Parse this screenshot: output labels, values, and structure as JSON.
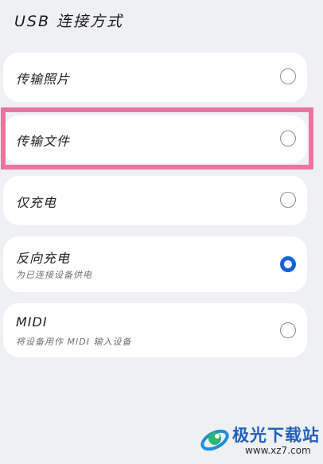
{
  "screen": {
    "title": "USB 连接方式"
  },
  "options": [
    {
      "label": "传输照片",
      "selected": false
    },
    {
      "label": "传输文件",
      "selected": false,
      "highlighted": true
    },
    {
      "label": "仅充电",
      "selected": false
    },
    {
      "label": "反向充电",
      "sublabel": "为已连接设备供电",
      "selected": true
    },
    {
      "label": "MIDI",
      "sublabel": "将设备用作 MIDI 输入设备",
      "selected": false
    }
  ],
  "watermark": {
    "name": "极光下载站",
    "url": "www.xz7.com"
  },
  "colors": {
    "accent": "#1464d9",
    "highlight_frame": "#e8759d",
    "background": "#eef0f3"
  }
}
